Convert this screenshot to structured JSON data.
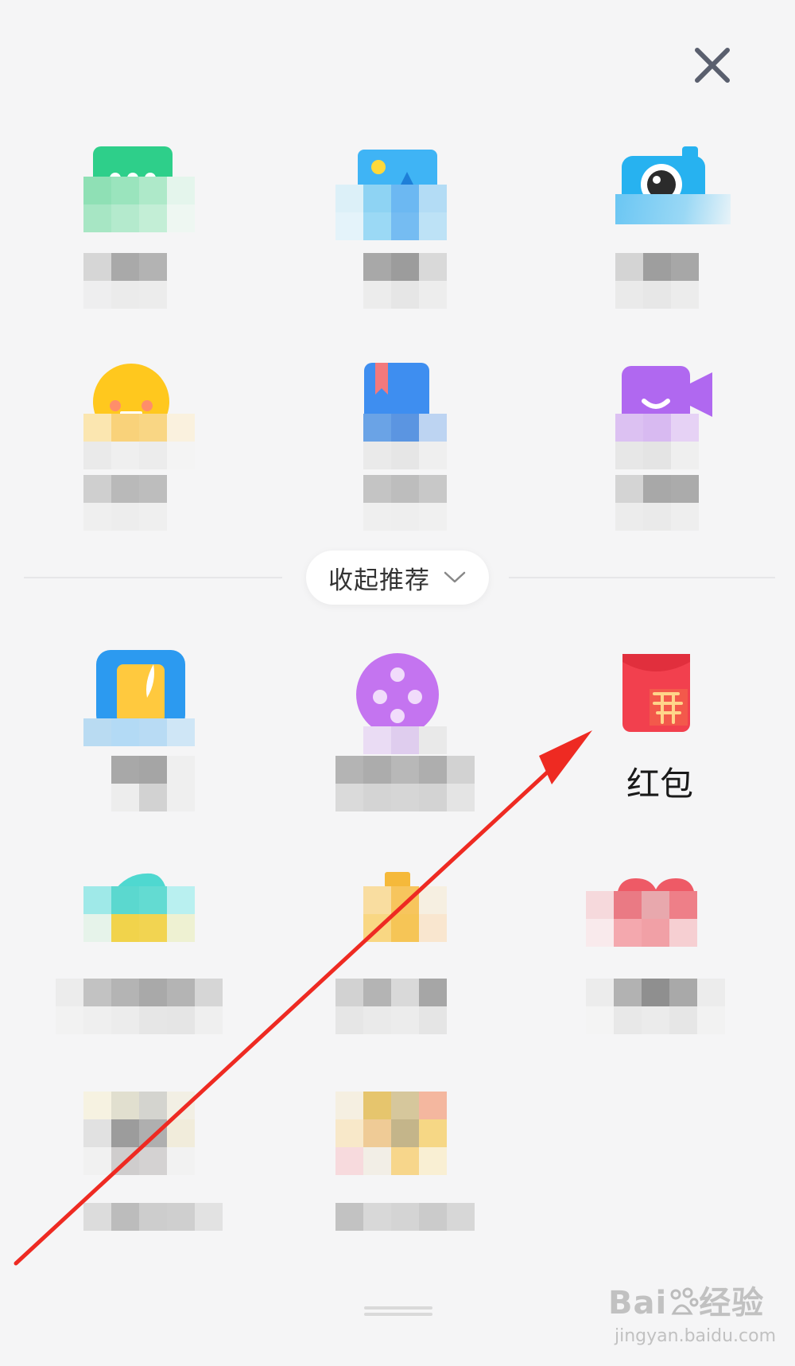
{
  "header": {
    "close_icon": "close-x-icon",
    "close_color": "#5a5f6e"
  },
  "divider": {
    "collapse_label": "收起推荐",
    "chevron_icon": "chevron-down-icon"
  },
  "apps": [
    {
      "id": "message",
      "icon": "message-bubble-icon",
      "label": "",
      "accent": "#2ecf8a"
    },
    {
      "id": "gallery",
      "icon": "photo-album-icon",
      "label": "",
      "accent": "#3fb4f5"
    },
    {
      "id": "camera",
      "icon": "camera-icon",
      "label": "",
      "accent": "#27b2f0"
    },
    {
      "id": "emoji",
      "icon": "emoji-face-icon",
      "label": "",
      "accent": "#ffc81e"
    },
    {
      "id": "book",
      "icon": "bookmark-book-icon",
      "label": "",
      "accent": "#3e8ef0"
    },
    {
      "id": "video",
      "icon": "video-camera-icon",
      "label": "",
      "accent": "#b068f0"
    },
    {
      "id": "notes",
      "icon": "notebook-feather-icon",
      "label": "",
      "accent": "#2c9af0"
    },
    {
      "id": "film",
      "icon": "film-reel-icon",
      "label": "",
      "accent": "#c474f0"
    },
    {
      "id": "redpacket",
      "icon": "red-packet-icon",
      "label": "红包",
      "accent": "#f2404e"
    },
    {
      "id": "app10",
      "icon": "teal-cup-icon",
      "label": "",
      "accent": "#4fd8d0"
    },
    {
      "id": "app11",
      "icon": "gift-bottle-icon",
      "label": "",
      "accent": "#f5b93a"
    },
    {
      "id": "app12",
      "icon": "heart-icon",
      "label": "",
      "accent": "#ee6670"
    },
    {
      "id": "app13",
      "icon": "blurred-app-icon",
      "label": "",
      "accent": "#bdbdbd"
    },
    {
      "id": "app14",
      "icon": "blurred-app-icon",
      "label": "",
      "accent": "#e8c46a"
    }
  ],
  "annotation": {
    "arrow_color": "#ee2a22"
  },
  "watermark": {
    "line1": "Bai",
    "line1_suffix": "经验",
    "line2": "jingyan.baidu.com",
    "paw_icon": "baidu-paw-icon"
  }
}
